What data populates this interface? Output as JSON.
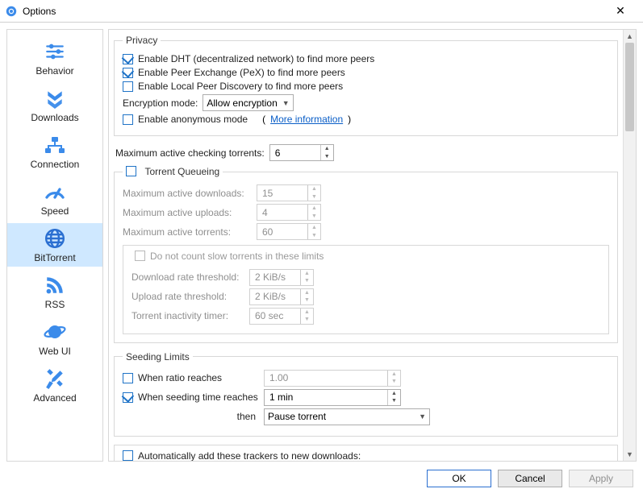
{
  "window": {
    "title": "Options"
  },
  "sidebar": {
    "items": [
      {
        "label": "Behavior"
      },
      {
        "label": "Downloads"
      },
      {
        "label": "Connection"
      },
      {
        "label": "Speed"
      },
      {
        "label": "BitTorrent"
      },
      {
        "label": "RSS"
      },
      {
        "label": "Web UI"
      },
      {
        "label": "Advanced"
      }
    ],
    "selected": "BitTorrent"
  },
  "privacy": {
    "legend": "Privacy",
    "dht_label": "Enable DHT (decentralized network) to find more peers",
    "dht_checked": true,
    "pex_label": "Enable Peer Exchange (PeX) to find more peers",
    "pex_checked": true,
    "lpd_label": "Enable Local Peer Discovery to find more peers",
    "lpd_checked": false,
    "encryption_label": "Encryption mode:",
    "encryption_value": "Allow encryption",
    "anon_label": "Enable anonymous mode",
    "anon_checked": false,
    "anon_info_link": "More information",
    "anon_info_paren_open": "(",
    "anon_info_paren_close": ")"
  },
  "checking": {
    "label": "Maximum active checking torrents:",
    "value": "6"
  },
  "queueing": {
    "title_label": "Torrent Queueing",
    "title_checked": false,
    "max_downloads_label": "Maximum active downloads:",
    "max_downloads_value": "15",
    "max_uploads_label": "Maximum active uploads:",
    "max_uploads_value": "4",
    "max_torrents_label": "Maximum active torrents:",
    "max_torrents_value": "60",
    "slow_label": "Do not count slow torrents in these limits",
    "slow_checked": false,
    "dl_thresh_label": "Download rate threshold:",
    "dl_thresh_value": "2 KiB/s",
    "ul_thresh_label": "Upload rate threshold:",
    "ul_thresh_value": "2 KiB/s",
    "inactivity_label": "Torrent inactivity timer:",
    "inactivity_value": "60 sec"
  },
  "seeding": {
    "legend": "Seeding Limits",
    "ratio_label": "When ratio reaches",
    "ratio_checked": false,
    "ratio_value": "1.00",
    "time_label": "When seeding time reaches",
    "time_checked": true,
    "time_value": "1 min",
    "then_label": "then",
    "then_value": "Pause torrent"
  },
  "trackers": {
    "auto_add_label": "Automatically add these trackers to new downloads:",
    "auto_add_checked": false
  },
  "footer": {
    "ok": "OK",
    "cancel": "Cancel",
    "apply": "Apply"
  }
}
